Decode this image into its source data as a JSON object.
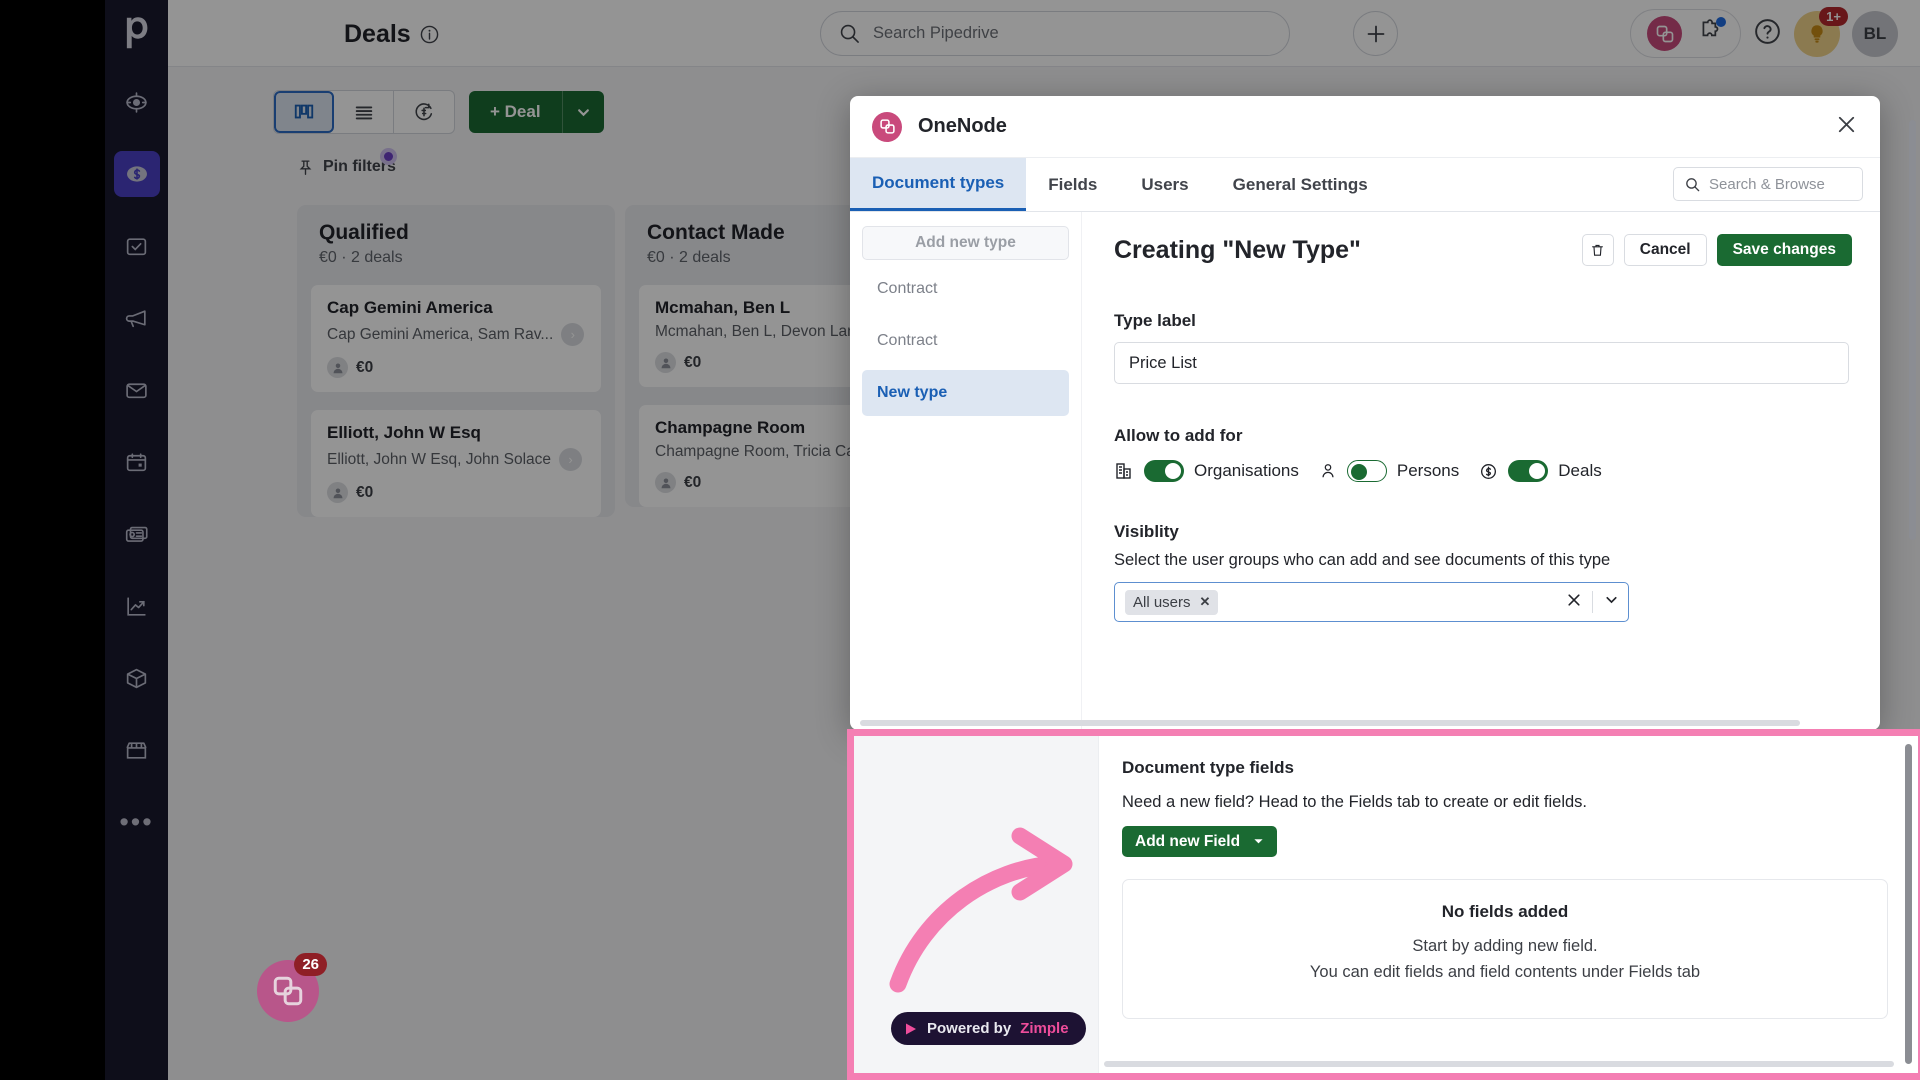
{
  "header": {
    "page_title": "Deals",
    "info_icon": "info-icon",
    "search_placeholder": "Search Pipedrive",
    "search_value": "",
    "add_button": "plus-icon",
    "onenode_icon": "onenode-icon",
    "puzzle_icon": "puzzle-icon",
    "help_icon": "help-question-icon",
    "bulb_icon": "lightbulb-icon",
    "bulb_badge": "1+",
    "avatar_initials": "BL"
  },
  "rail": {
    "logo": "pipedrive-logo",
    "items": [
      {
        "icon": "target-icon",
        "active": false
      },
      {
        "icon": "deals-dollar-icon",
        "active": true
      },
      {
        "icon": "activities-checkbox-icon",
        "active": false
      },
      {
        "icon": "campaigns-megaphone-icon",
        "active": false
      },
      {
        "icon": "mail-envelope-icon",
        "active": false
      },
      {
        "icon": "calendar-icon",
        "active": false
      },
      {
        "icon": "contacts-card-icon",
        "active": false
      },
      {
        "icon": "insights-chart-icon",
        "active": false
      },
      {
        "icon": "products-box-icon",
        "active": false
      },
      {
        "icon": "marketplace-store-icon",
        "active": false
      }
    ],
    "more": "more-dots-icon"
  },
  "toolbar": {
    "view_board": "board-view-icon",
    "view_list": "list-view-icon",
    "view_forecast": "forecast-view-icon",
    "deal_button": "+ Deal",
    "deal_caret": "chevron-down-icon",
    "pin_filters": "Pin filters",
    "pin_icon": "pin-icon"
  },
  "pipeline": {
    "columns": [
      {
        "name": "Qualified",
        "summary": "€0 · 2 deals",
        "cards": [
          {
            "title": "Cap Gemini America",
            "subtitle": "Cap Gemini America, Sam Rav...",
            "value": "€0"
          },
          {
            "title": "Elliott, John W Esq",
            "subtitle": "Elliott, John W Esq, John Solace",
            "value": "€0"
          }
        ]
      },
      {
        "name": "Contact Made",
        "summary": "€0 · 2 deals",
        "cards": [
          {
            "title": "Mcmahan, Ben L",
            "subtitle": "Mcmahan, Ben L, Devon Lang...",
            "value": "€0"
          },
          {
            "title": "Champagne Room",
            "subtitle": "Champagne Room, Tricia Cas...",
            "value": "€0"
          }
        ]
      }
    ]
  },
  "modal": {
    "app_name": "OneNode",
    "app_icon": "onenode-icon",
    "close_icon": "close-x-icon",
    "tabs": [
      {
        "label": "Document types",
        "active": true
      },
      {
        "label": "Fields",
        "active": false
      },
      {
        "label": "Users",
        "active": false
      },
      {
        "label": "General Settings",
        "active": false
      }
    ],
    "search_placeholder": "Search & Browse",
    "search_icon": "search-icon",
    "type_list": {
      "add_new": "Add new type",
      "items": [
        {
          "label": "Contract",
          "active": false
        },
        {
          "label": "Contract",
          "active": false
        },
        {
          "label": "New type",
          "active": true
        }
      ]
    },
    "form": {
      "heading": "Creating \"New Type\"",
      "delete_icon": "trash-icon",
      "cancel_label": "Cancel",
      "save_label": "Save changes",
      "type_label_title": "Type label",
      "type_label_value": "Price List",
      "type_label_placeholder": "Type label",
      "allow_title": "Allow to add for",
      "toggles": [
        {
          "icon": "organisation-building-icon",
          "label": "Organisations",
          "on": true
        },
        {
          "icon": "person-icon",
          "label": "Persons",
          "on": false
        },
        {
          "icon": "deal-dollar-icon",
          "label": "Deals",
          "on": true
        }
      ],
      "visibility_title": "Visiblity",
      "visibility_help": "Select the user groups who can add and see documents of this type",
      "visibility_chip": "All users",
      "chip_remove_icon": "chip-remove-x-icon",
      "clear_icon": "clear-x-icon",
      "dropdown_icon": "chevron-down-icon"
    }
  },
  "highlight": {
    "fields_title": "Document type fields",
    "fields_help": "Need a new field? Head to the Fields tab to create or edit fields.",
    "add_field_label": "Add new Field",
    "add_field_caret": "chevron-down-icon",
    "empty_title": "No fields added",
    "empty_line1": "Start by adding new field.",
    "empty_line2": "You can edit fields and field contents under Fields tab",
    "badge_text_prefix": "Powered by ",
    "badge_brand": "Zimple",
    "badge_icon": "play-triangle-icon",
    "arrow_icon": "curved-arrow-icon",
    "highlight_color": "#f47fb3"
  },
  "chat": {
    "icon": "onenode-chat-icon",
    "badge": "26"
  }
}
